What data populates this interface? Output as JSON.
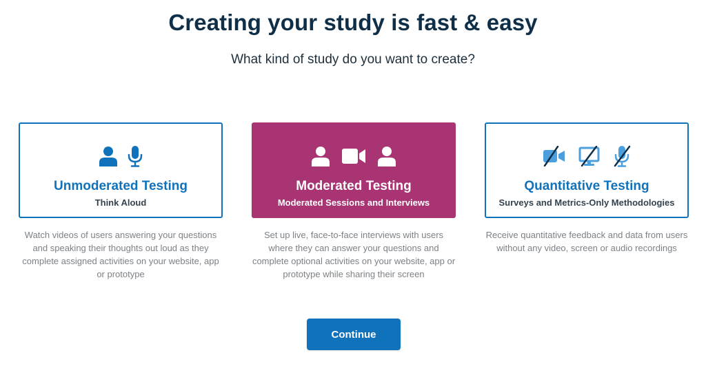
{
  "header": {
    "title": "Creating your study is fast & easy",
    "subtitle": "What kind of study do you want to create?"
  },
  "cards": [
    {
      "title": "Unmoderated Testing",
      "subtitle": "Think Aloud",
      "description": "Watch videos of users answering your questions and speaking their thoughts out loud as they complete assigned activities on your website, app or prototype",
      "icons": [
        "user-icon",
        "microphone-icon"
      ],
      "selected": false
    },
    {
      "title": "Moderated Testing",
      "subtitle": "Moderated Sessions and Interviews",
      "description": "Set up live, face-to-face interviews with users where they can answer your questions and complete optional activities on your website, app or prototype while sharing their screen",
      "icons": [
        "user-icon",
        "video-camera-icon",
        "user-icon"
      ],
      "selected": true
    },
    {
      "title": "Quantitative Testing",
      "subtitle": "Surveys and Metrics-Only Methodologies",
      "description": "Receive quantitative feedback and data from users without any video, screen or audio recordings",
      "icons": [
        "no-video-icon",
        "no-screen-icon",
        "no-microphone-icon"
      ],
      "selected": false
    }
  ],
  "actions": {
    "continue_label": "Continue"
  },
  "colors": {
    "primary": "#1172bc",
    "selected_card": "#a83474",
    "title_text": "#0f2f48",
    "description_text": "#7b8186",
    "disabled_icon": "#4a9fdc"
  }
}
